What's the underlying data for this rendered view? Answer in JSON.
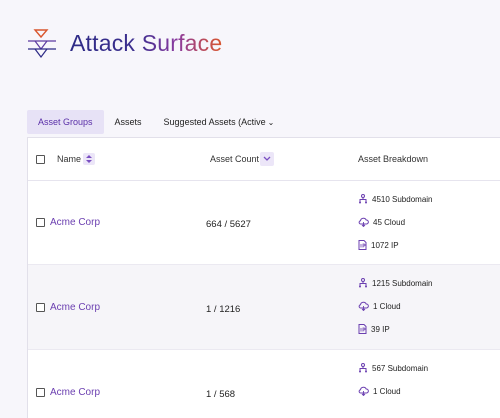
{
  "header": {
    "title": "Attack Surface"
  },
  "tabs": [
    {
      "label": "Asset Groups"
    },
    {
      "label": "Assets"
    },
    {
      "label": "Suggested Assets (Active"
    }
  ],
  "table": {
    "columns": {
      "name": "Name",
      "count": "Asset Count",
      "breakdown": "Asset Breakdown"
    },
    "rows": [
      {
        "name": "Acme Corp",
        "count": "664 / 5627",
        "subdomain": "4510 Subdomain",
        "cloud": "45 Cloud",
        "ip": "1072 IP"
      },
      {
        "name": "Acme Corp",
        "count": "1 / 1216",
        "subdomain": "1215 Subdomain",
        "cloud": "1 Cloud",
        "ip": "39 IP"
      },
      {
        "name": "Acme Corp",
        "count": "1 / 568",
        "subdomain": "567 Subdomain",
        "cloud": "1 Cloud",
        "ip": ""
      }
    ]
  },
  "colors": {
    "accent": "#6b3fb0",
    "tab_active_bg": "#e7e2f6"
  },
  "icons": [
    "attack-surface-logo-icon",
    "sort-icon",
    "chevron-down-icon",
    "subdomain-icon",
    "cloud-icon",
    "ip-icon"
  ]
}
